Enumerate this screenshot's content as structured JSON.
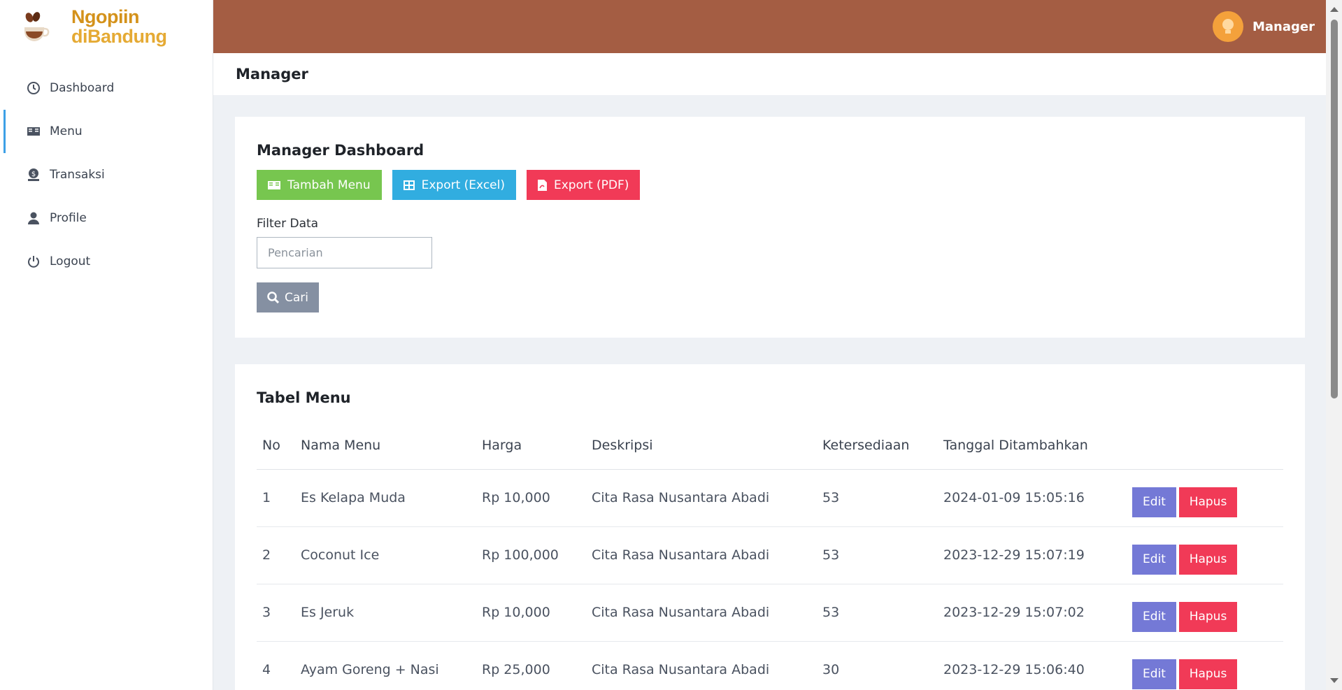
{
  "brand": {
    "line1": "Ngopiin",
    "line2": "diBandung"
  },
  "sidebar": {
    "items": [
      {
        "label": "Dashboard",
        "icon": "clock-icon"
      },
      {
        "label": "Menu",
        "icon": "book-icon",
        "active": true
      },
      {
        "label": "Transaksi",
        "icon": "money-icon"
      },
      {
        "label": "Profile",
        "icon": "user-icon"
      },
      {
        "label": "Logout",
        "icon": "power-icon"
      }
    ]
  },
  "topbar": {
    "username": "Manager"
  },
  "page": {
    "title": "Manager"
  },
  "dashboard": {
    "title": "Manager Dashboard",
    "buttons": {
      "tambah": "Tambah Menu",
      "excel": "Export (Excel)",
      "pdf": "Export (PDF)"
    },
    "filter_label": "Filter Data",
    "search_placeholder": "Pencarian",
    "search_button": "Cari"
  },
  "table": {
    "title": "Tabel Menu",
    "headers": [
      "No",
      "Nama Menu",
      "Harga",
      "Deskripsi",
      "Ketersediaan",
      "Tanggal Ditambahkan"
    ],
    "rows": [
      [
        "1",
        "Es Kelapa Muda",
        "Rp 10,000",
        "Cita Rasa Nusantara Abadi",
        "53",
        "2024-01-09 15:05:16"
      ],
      [
        "2",
        "Coconut Ice",
        "Rp 100,000",
        "Cita Rasa Nusantara Abadi",
        "53",
        "2023-12-29 15:07:19"
      ],
      [
        "3",
        "Es Jeruk",
        "Rp 10,000",
        "Cita Rasa Nusantara Abadi",
        "53",
        "2023-12-29 15:07:02"
      ],
      [
        "4",
        "Ayam Goreng + Nasi",
        "Rp 25,000",
        "Cita Rasa Nusantara Abadi",
        "30",
        "2023-12-29 15:06:40"
      ]
    ],
    "edit_label": "Edit",
    "delete_label": "Hapus"
  },
  "colors": {
    "topbar": "#a45d43",
    "brand_orange": "#d4921b",
    "btn_green": "#77c64f",
    "btn_blue": "#31ade0",
    "btn_red": "#f13a57",
    "btn_edit": "#7479d6",
    "active_bar": "#3da0e6"
  }
}
